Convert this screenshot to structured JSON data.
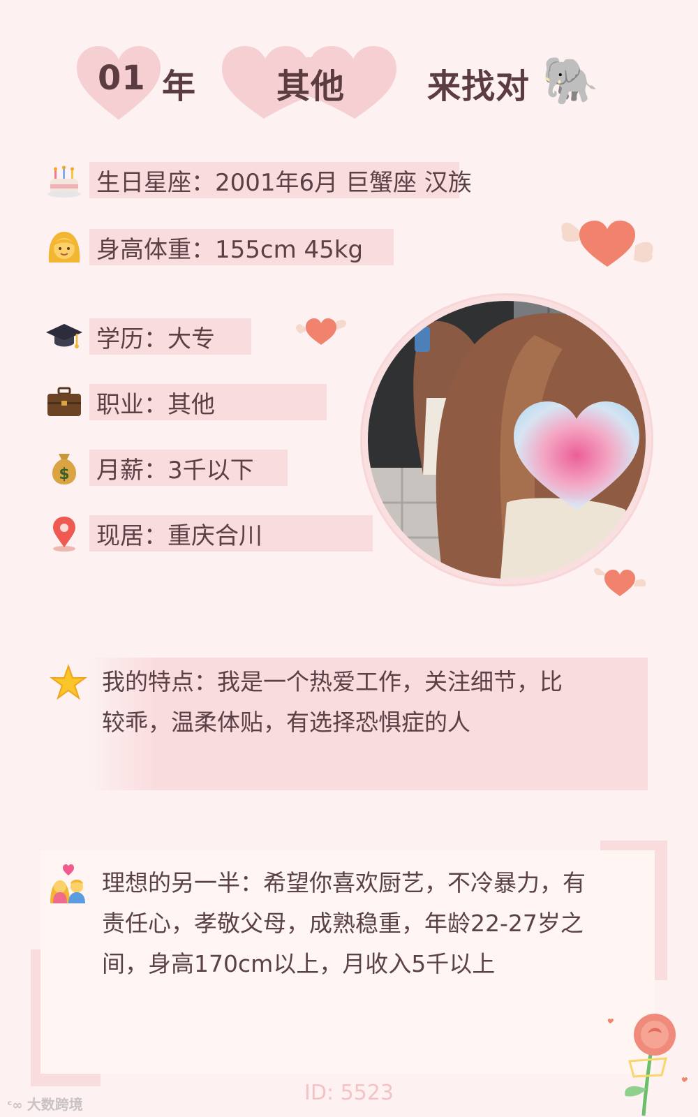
{
  "header": {
    "year": "01",
    "year_suffix": "年",
    "middle": "其他",
    "right": "来找对",
    "emoji": "🐘"
  },
  "rows": [
    {
      "label": "生日星座：",
      "value": "2001年6月 巨蟹座 汉族",
      "icon": "cake-icon"
    },
    {
      "label": "身高体重：",
      "value": "155cm 45kg",
      "icon": "girl-face-icon"
    },
    {
      "label": "学历：",
      "value": "大专",
      "icon": "graduation-cap-icon"
    },
    {
      "label": "职业：",
      "value": "其他",
      "icon": "briefcase-icon"
    },
    {
      "label": "月薪：",
      "value": "3千以下",
      "icon": "money-bag-icon"
    },
    {
      "label": "现居：",
      "value": "重庆合川",
      "icon": "location-pin-icon"
    }
  ],
  "features": {
    "label": "我的特点：",
    "text": "我是一个热爱工作，关注细节，比较乖，温柔体贴，有选择恐惧症的人",
    "line1": "我的特点：我是一个热爱工作，关注细节，比",
    "line2": "较乖，温柔体贴，有选择恐惧症的人"
  },
  "ideal": {
    "label": "理想的另一半：",
    "line1": "理想的另一半：希望你喜欢厨艺，不冷暴力，有",
    "line2": "责任心，孝敬父母，成熟稳重，年龄22-27岁之",
    "line3": "间，身高170cm以上，月收入5千以上"
  },
  "footer": {
    "id_text": "ID: 5523",
    "watermark": "大数跨境"
  },
  "colors": {
    "background": "#fdf1f1",
    "row_highlight": "#f9dcde",
    "heart_pink": "#f5c9cc",
    "accent_coral": "#f08c7a",
    "text": "#5a4145"
  }
}
